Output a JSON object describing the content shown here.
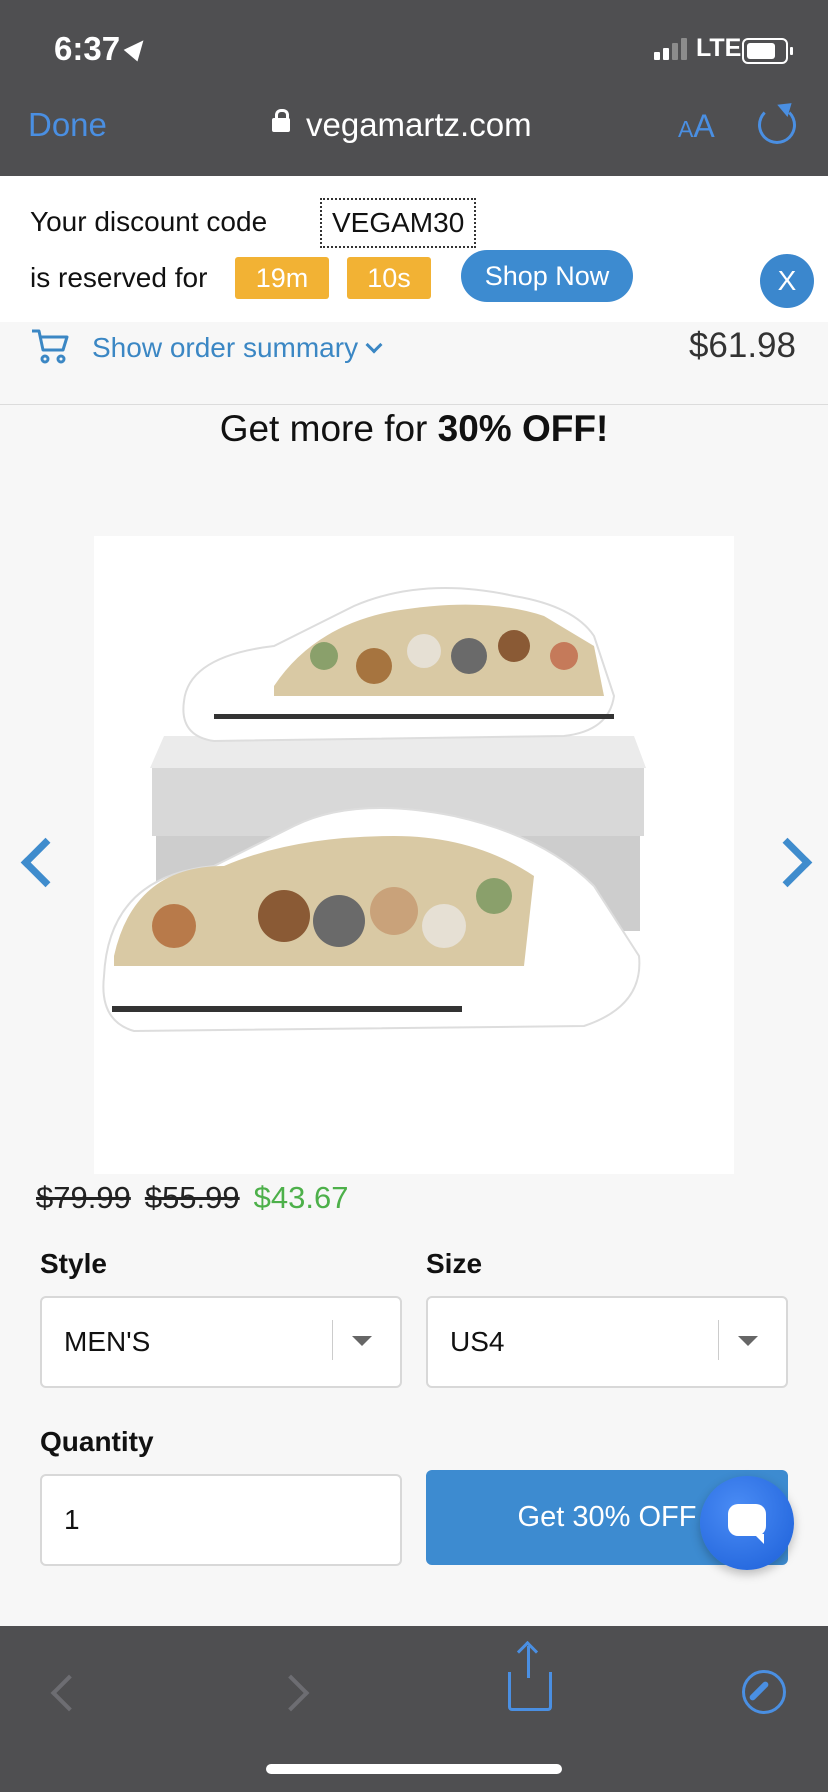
{
  "status_bar": {
    "time": "6:37",
    "network": "LTE"
  },
  "browser": {
    "done_label": "Done",
    "url": "vegamartz.com",
    "aa_small": "A",
    "aa_large": "A"
  },
  "discount": {
    "line1": "Your discount code",
    "code": "VEGAM30",
    "line2": "is reserved for",
    "minutes": "19m",
    "seconds": "10s",
    "shop_now": "Shop Now",
    "close": "X"
  },
  "summary": {
    "link": "Show order summary",
    "total": "$61.98"
  },
  "headline": {
    "prefix": "Get more for ",
    "bold": "30% OFF!"
  },
  "prices": {
    "original": "$79.99",
    "compare": "$55.99",
    "sale": "$43.67"
  },
  "form": {
    "style_label": "Style",
    "style_value": "MEN'S",
    "size_label": "Size",
    "size_value": "US4",
    "quantity_label": "Quantity",
    "quantity_value": "1",
    "cta": "Get 30% OFF"
  },
  "colors": {
    "accent": "#3d8bd0",
    "timer": "#f2b234",
    "sale_price": "#4db04a",
    "chrome": "#4f4f51"
  }
}
